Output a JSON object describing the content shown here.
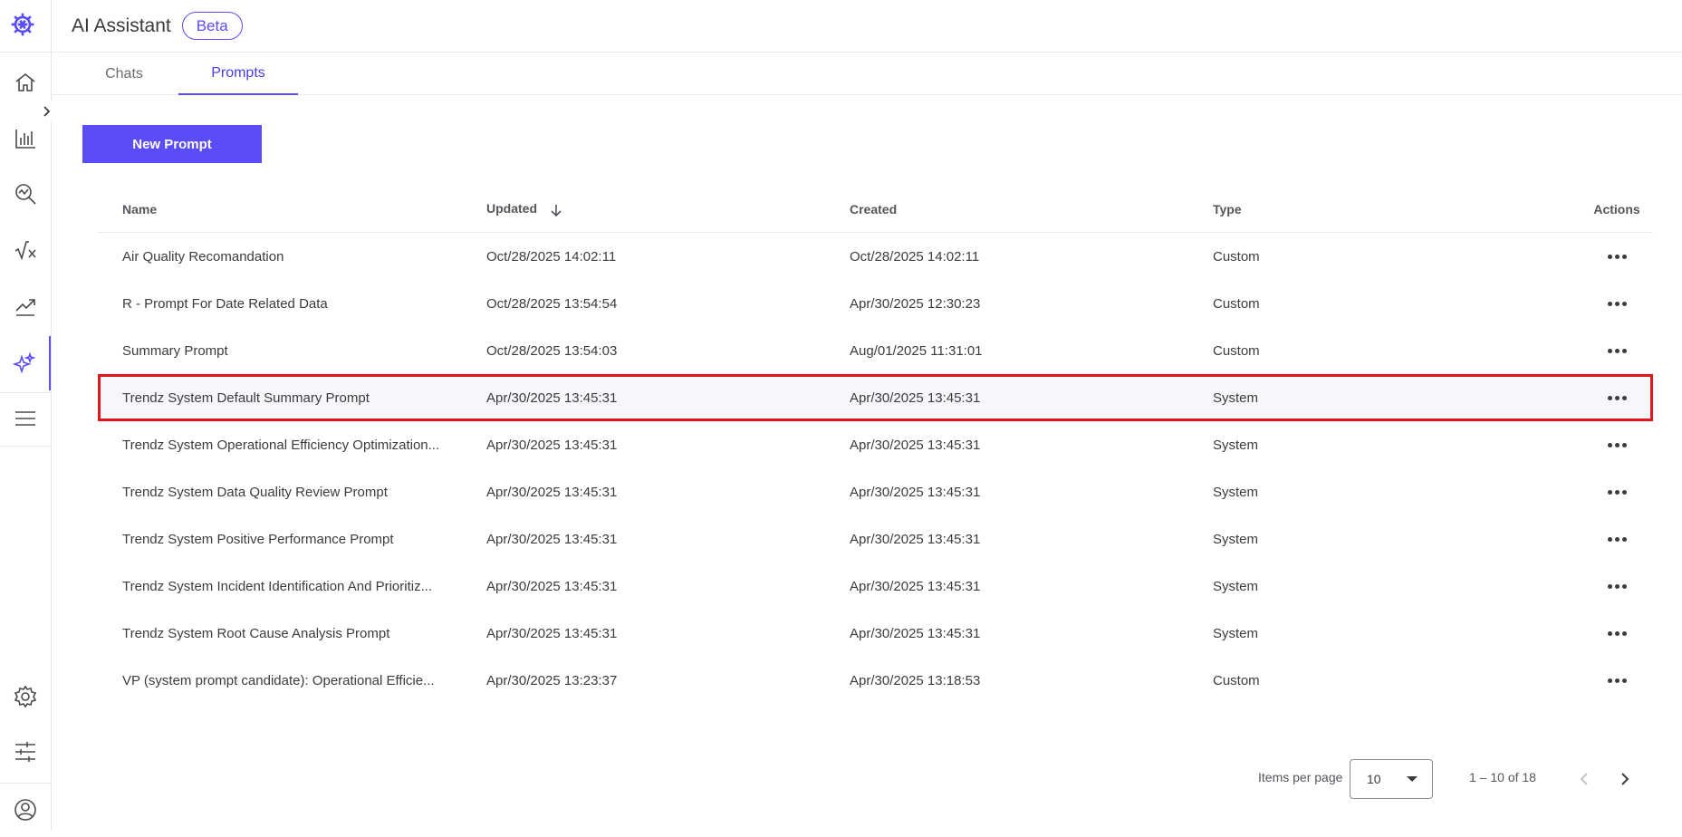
{
  "app": {
    "title": "AI Assistant",
    "badge": "Beta"
  },
  "tabs": [
    {
      "label": "Chats",
      "active": false
    },
    {
      "label": "Prompts",
      "active": true
    }
  ],
  "new_prompt_label": "New Prompt",
  "columns": {
    "name": "Name",
    "updated": "Updated",
    "created": "Created",
    "type": "Type",
    "actions": "Actions"
  },
  "rows": [
    {
      "name": "Air Quality Recomandation",
      "updated": "Oct/28/2025 14:02:11",
      "created": "Oct/28/2025 14:02:11",
      "type": "Custom"
    },
    {
      "name": "R - Prompt For Date Related Data",
      "updated": "Oct/28/2025 13:54:54",
      "created": "Apr/30/2025 12:30:23",
      "type": "Custom"
    },
    {
      "name": "Summary Prompt",
      "updated": "Oct/28/2025 13:54:03",
      "created": "Aug/01/2025 11:31:01",
      "type": "Custom"
    },
    {
      "name": "Trendz System Default Summary Prompt",
      "updated": "Apr/30/2025 13:45:31",
      "created": "Apr/30/2025 13:45:31",
      "type": "System"
    },
    {
      "name": "Trendz System Operational Efficiency Optimization...",
      "updated": "Apr/30/2025 13:45:31",
      "created": "Apr/30/2025 13:45:31",
      "type": "System"
    },
    {
      "name": "Trendz System Data Quality Review Prompt",
      "updated": "Apr/30/2025 13:45:31",
      "created": "Apr/30/2025 13:45:31",
      "type": "System"
    },
    {
      "name": "Trendz System Positive Performance Prompt",
      "updated": "Apr/30/2025 13:45:31",
      "created": "Apr/30/2025 13:45:31",
      "type": "System"
    },
    {
      "name": "Trendz System Incident Identification And Prioritiz...",
      "updated": "Apr/30/2025 13:45:31",
      "created": "Apr/30/2025 13:45:31",
      "type": "System"
    },
    {
      "name": "Trendz System Root Cause Analysis Prompt",
      "updated": "Apr/30/2025 13:45:31",
      "created": "Apr/30/2025 13:45:31",
      "type": "System"
    },
    {
      "name": "VP (system prompt candidate): Operational Efficie...",
      "updated": "Apr/30/2025 13:23:37",
      "created": "Apr/30/2025 13:18:53",
      "type": "Custom"
    }
  ],
  "highlighted_row": 3,
  "pagination": {
    "items_per_page_label": "Items per page",
    "items_per_page": "10",
    "range": "1 – 10 of 18"
  },
  "colors": {
    "accent": "#5a4cf7",
    "highlight_border": "#e0161f"
  }
}
